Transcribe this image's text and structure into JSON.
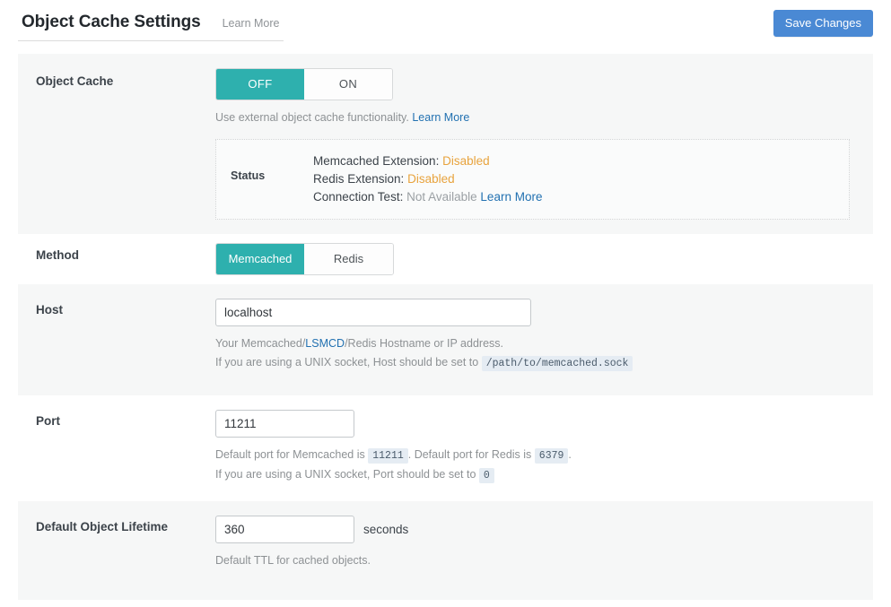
{
  "header": {
    "title": "Object Cache Settings",
    "learn_more_label": "Learn More",
    "save_label": "Save Changes",
    "save_color": "#4a89d4"
  },
  "theme": {
    "active_toggle_color": "#2eb0ae",
    "link_color": "#2271b1",
    "warning_color": "#e8a33d",
    "muted_color": "#9ba0a4",
    "shaded_row_color": "#f6f7f7"
  },
  "rows": {
    "object_cache": {
      "label": "Object Cache",
      "toggle": {
        "off_label": "OFF",
        "on_label": "ON",
        "selected": "OFF"
      },
      "help_prefix": "Use external object cache functionality.",
      "help_link": "Learn More",
      "status": {
        "title": "Status",
        "memcached_label": "Memcached Extension:",
        "memcached_value": "Disabled",
        "redis_label": "Redis Extension:",
        "redis_value": "Disabled",
        "connection_label": "Connection Test:",
        "connection_value": "Not Available",
        "connection_link": "Learn More"
      }
    },
    "method": {
      "label": "Method",
      "toggle": {
        "memcached_label": "Memcached",
        "redis_label": "Redis",
        "selected": "Memcached"
      }
    },
    "host": {
      "label": "Host",
      "value": "localhost",
      "placeholder": "localhost",
      "help_line1_prefix": "Your Memcached/",
      "help_line1_link": "LSMCD",
      "help_line1_suffix": "/Redis Hostname or IP address.",
      "help_line2_prefix": "If you are using a UNIX socket, Host should be set to",
      "help_line2_code": "/path/to/memcached.sock"
    },
    "port": {
      "label": "Port",
      "value": "11211",
      "placeholder": "11211",
      "help_line1_part1": "Default port for Memcached is",
      "help_line1_code1": "11211",
      "help_line1_part2": ". Default port for Redis is",
      "help_line1_code2": "6379",
      "help_line1_part3": ".",
      "help_line2_prefix": "If you are using a UNIX socket, Port should be set to",
      "help_line2_code": "0"
    },
    "lifetime": {
      "label": "Default Object Lifetime",
      "value": "360",
      "placeholder": "360",
      "unit": "seconds",
      "help": "Default TTL for cached objects."
    }
  }
}
